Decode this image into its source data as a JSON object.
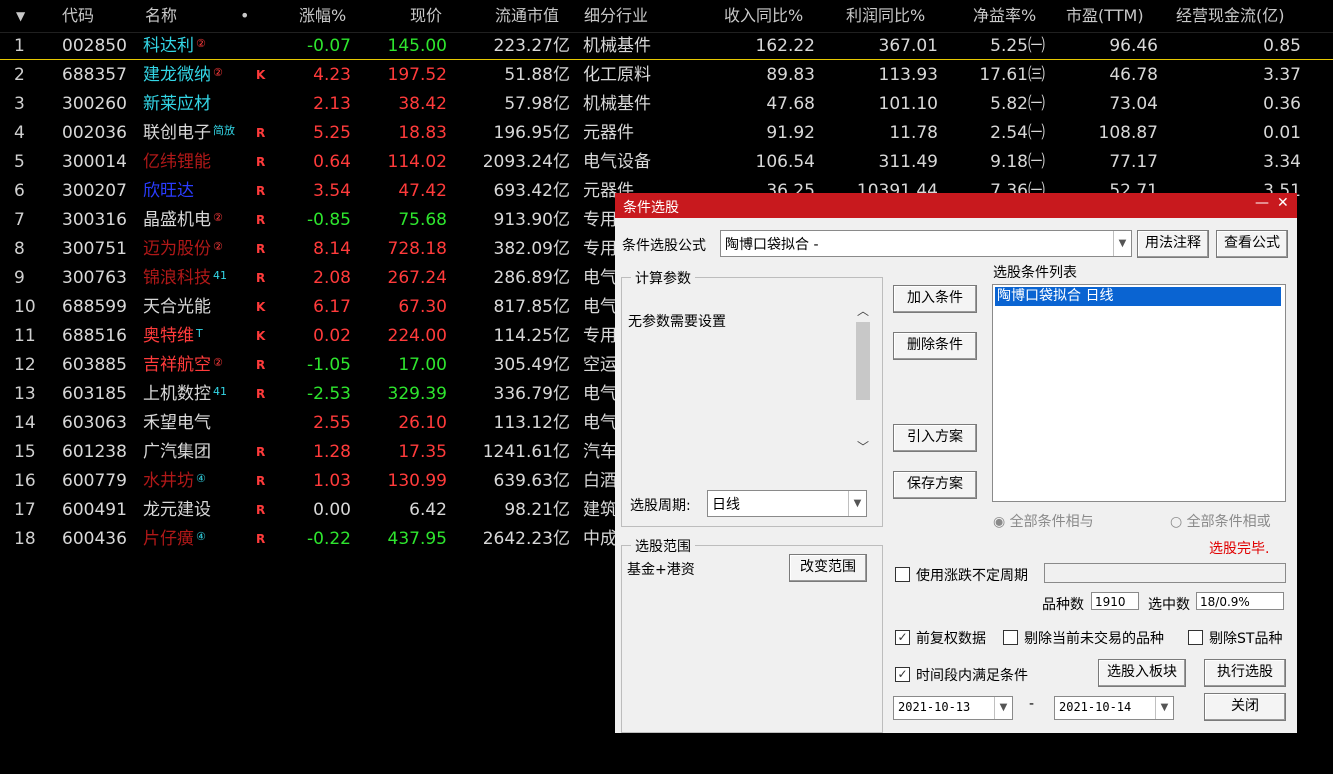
{
  "table": {
    "headers": {
      "sort": "▼",
      "code": "代码",
      "name": "名称",
      "dot": "•",
      "chg": "涨幅%",
      "price": "现价",
      "cap": "流通市值",
      "ind": "细分行业",
      "rev": "收入同比%",
      "prof": "利润同比%",
      "roe": "净益率%",
      "pe": "市盈(TTM)",
      "cash": "经营现金流(亿)"
    },
    "rows": [
      {
        "idx": "1",
        "code": "002850",
        "name": "科达利",
        "name_color": "#33d6e6",
        "sup": "②",
        "flag": "",
        "chg": "-0.07",
        "dir": "down",
        "price": "145.00",
        "cap": "223.27亿",
        "ind": "机械基件",
        "rev": "162.22",
        "prof": "367.01",
        "roe": "5.25㈠",
        "pe": "96.46",
        "cash": "0.85"
      },
      {
        "idx": "2",
        "code": "688357",
        "name": "建龙微纳",
        "name_color": "#33d6e6",
        "sup": "②",
        "flag": "K",
        "chg": "4.23",
        "dir": "up",
        "price": "197.52",
        "cap": "51.88亿",
        "ind": "化工原料",
        "rev": "89.83",
        "prof": "113.93",
        "roe": "17.61㈢",
        "pe": "46.78",
        "cash": "3.37"
      },
      {
        "idx": "3",
        "code": "300260",
        "name": "新莱应材",
        "name_color": "#33d6e6",
        "sup": "",
        "flag": "",
        "chg": "2.13",
        "dir": "up",
        "price": "38.42",
        "cap": "57.98亿",
        "ind": "机械基件",
        "rev": "47.68",
        "prof": "101.10",
        "roe": "5.82㈠",
        "pe": "73.04",
        "cash": "0.36"
      },
      {
        "idx": "4",
        "code": "002036",
        "name": "联创电子",
        "name_color": "#d8d8d8",
        "sup": "简放",
        "flag": "R",
        "chg": "5.25",
        "dir": "up",
        "price": "18.83",
        "cap": "196.95亿",
        "ind": "元器件",
        "rev": "91.92",
        "prof": "11.78",
        "roe": "2.54㈠",
        "pe": "108.87",
        "cash": "0.01"
      },
      {
        "idx": "5",
        "code": "300014",
        "name": "亿纬锂能",
        "name_color": "#b01818",
        "sup": "",
        "flag": "R",
        "chg": "0.64",
        "dir": "up",
        "price": "114.02",
        "cap": "2093.24亿",
        "ind": "电气设备",
        "rev": "106.54",
        "prof": "311.49",
        "roe": "9.18㈠",
        "pe": "77.17",
        "cash": "3.34"
      },
      {
        "idx": "6",
        "code": "300207",
        "name": "欣旺达",
        "name_color": "#2a3cff",
        "sup": "",
        "flag": "R",
        "chg": "3.54",
        "dir": "up",
        "price": "47.42",
        "cap": "693.42亿",
        "ind": "元器件",
        "rev": "36.25",
        "prof": "10391.44",
        "roe": "7.36㈠",
        "pe": "52.71",
        "cash": "3.51"
      },
      {
        "idx": "7",
        "code": "300316",
        "name": "晶盛机电",
        "name_color": "#d8d8d8",
        "sup": "②",
        "flag": "R",
        "chg": "-0.85",
        "dir": "down",
        "price": "75.68",
        "cap": "913.90亿",
        "ind": "专用",
        "rev": "",
        "prof": "",
        "roe": "",
        "pe": "",
        "cash": ""
      },
      {
        "idx": "8",
        "code": "300751",
        "name": "迈为股份",
        "name_color": "#b01818",
        "sup": "②",
        "flag": "R",
        "chg": "8.14",
        "dir": "up",
        "price": "728.18",
        "cap": "382.09亿",
        "ind": "专用",
        "rev": "",
        "prof": "",
        "roe": "",
        "pe": "",
        "cash": ""
      },
      {
        "idx": "9",
        "code": "300763",
        "name": "锦浪科技",
        "name_color": "#b01818",
        "sup": "41",
        "flag": "R",
        "chg": "2.08",
        "dir": "up",
        "price": "267.24",
        "cap": "286.89亿",
        "ind": "电气",
        "rev": "",
        "prof": "",
        "roe": "",
        "pe": "",
        "cash": ""
      },
      {
        "idx": "10",
        "code": "688599",
        "name": "天合光能",
        "name_color": "#d8d8d8",
        "sup": "",
        "flag": "K",
        "chg": "6.17",
        "dir": "up",
        "price": "67.30",
        "cap": "817.85亿",
        "ind": "电气",
        "rev": "",
        "prof": "",
        "roe": "",
        "pe": "",
        "cash": ""
      },
      {
        "idx": "11",
        "code": "688516",
        "name": "奥特维",
        "name_color": "#ff3b3b",
        "sup": "T",
        "flag": "K",
        "chg": "0.02",
        "dir": "up",
        "price": "224.00",
        "cap": "114.25亿",
        "ind": "专用",
        "rev": "",
        "prof": "",
        "roe": "",
        "pe": "",
        "cash": ""
      },
      {
        "idx": "12",
        "code": "603885",
        "name": "吉祥航空",
        "name_color": "#ff3b3b",
        "sup": "②",
        "flag": "R",
        "chg": "-1.05",
        "dir": "down",
        "price": "17.00",
        "cap": "305.49亿",
        "ind": "空运",
        "rev": "",
        "prof": "",
        "roe": "",
        "pe": "",
        "cash": ""
      },
      {
        "idx": "13",
        "code": "603185",
        "name": "上机数控",
        "name_color": "#d8d8d8",
        "sup": "41",
        "flag": "R",
        "chg": "-2.53",
        "dir": "down",
        "price": "329.39",
        "cap": "336.79亿",
        "ind": "电气",
        "rev": "",
        "prof": "",
        "roe": "",
        "pe": "",
        "cash": ""
      },
      {
        "idx": "14",
        "code": "603063",
        "name": "禾望电气",
        "name_color": "#d8d8d8",
        "sup": "",
        "flag": "",
        "chg": "2.55",
        "dir": "up",
        "price": "26.10",
        "cap": "113.12亿",
        "ind": "电气",
        "rev": "",
        "prof": "",
        "roe": "",
        "pe": "",
        "cash": ""
      },
      {
        "idx": "15",
        "code": "601238",
        "name": "广汽集团",
        "name_color": "#d8d8d8",
        "sup": "",
        "flag": "R",
        "chg": "1.28",
        "dir": "up",
        "price": "17.35",
        "cap": "1241.61亿",
        "ind": "汽车",
        "rev": "",
        "prof": "",
        "roe": "",
        "pe": "",
        "cash": ""
      },
      {
        "idx": "16",
        "code": "600779",
        "name": "水井坊",
        "name_color": "#b01818",
        "sup": "④",
        "flag": "R",
        "chg": "1.03",
        "dir": "up",
        "price": "130.99",
        "cap": "639.63亿",
        "ind": "白酒",
        "rev": "",
        "prof": "",
        "roe": "",
        "pe": "",
        "cash": ""
      },
      {
        "idx": "17",
        "code": "600491",
        "name": "龙元建设",
        "name_color": "#d8d8d8",
        "sup": "",
        "flag": "R",
        "chg": "0.00",
        "dir": "flat",
        "price": "6.42",
        "cap": "98.21亿",
        "ind": "建筑",
        "rev": "",
        "prof": "",
        "roe": "",
        "pe": "",
        "cash": ""
      },
      {
        "idx": "18",
        "code": "600436",
        "name": "片仔癀",
        "name_color": "#b01818",
        "sup": "④",
        "flag": "R",
        "chg": "-0.22",
        "dir": "down",
        "price": "437.95",
        "cap": "2642.23亿",
        "ind": "中成",
        "rev": "",
        "prof": "",
        "roe": "",
        "pe": "",
        "cash": ""
      }
    ]
  },
  "dialog": {
    "title": "条件选股",
    "minimize": "—",
    "close": "✕",
    "formula_label": "条件选股公式",
    "formula_value": "陶博口袋拟合 -",
    "usage_button": "用法注释",
    "view_button": "查看公式",
    "params_legend": "计算参数",
    "params_text": "无参数需要设置",
    "add_button": "加入条件",
    "delete_button": "删除条件",
    "import_button": "引入方案",
    "save_button": "保存方案",
    "cond_list_label": "选股条件列表",
    "cond_items": [
      "陶博口袋拟合  日线"
    ],
    "period_label": "选股周期:",
    "period_value": "日线",
    "and_radio": "全部条件相与",
    "or_radio": "全部条件相或",
    "status": "选股完毕.",
    "scope_legend": "选股范围",
    "scope_value": "基金+港资",
    "change_scope_button": "改变范围",
    "uncertain_period_label": "使用涨跌不定周期",
    "count_label": "品种数",
    "count_value": "1910",
    "selected_label": "选中数",
    "selected_value": "18/0.9%",
    "prefq_label": "前复权数据",
    "exclude_untraded_label": "剔除当前未交易的品种",
    "exclude_st_label": "剔除ST品种",
    "timespan_label": "时间段内满足条件",
    "to_block_button": "选股入板块",
    "run_button": "执行选股",
    "close_button": "关闭",
    "date_from": "2021-10-13",
    "date_sep": "-",
    "date_to": "2021-10-14",
    "check_mark": "✓",
    "arrow_down": "▼",
    "scroll_up": "︿",
    "scroll_down": "﹀",
    "radio_on": "◉",
    "radio_off": "○"
  }
}
